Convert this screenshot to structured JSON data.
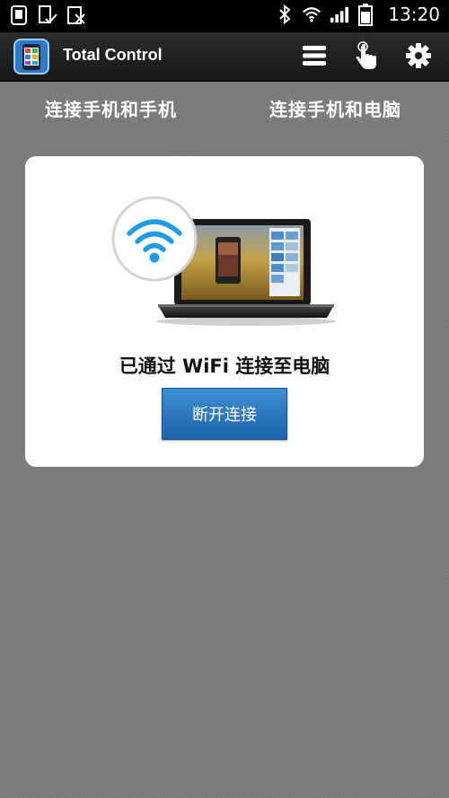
{
  "status_bar": {
    "time": "13:20",
    "icons_left": [
      "app-notification-icon",
      "download-check-icon",
      "blocked-sim-icon"
    ],
    "icons_right": [
      "bluetooth-icon",
      "wifi-signal-icon",
      "cell-signal-icon",
      "battery-icon"
    ]
  },
  "app_bar": {
    "title": "Total Control",
    "actions": [
      "menu-icon",
      "touch-hand-icon",
      "settings-gear-icon"
    ]
  },
  "top_tabs": {
    "phone_to_phone": "连接手机和手机",
    "phone_to_pc": "连接手机和电脑"
  },
  "card": {
    "status": "已通过 WiFi 连接至电脑",
    "disconnect_label": "断开连接"
  },
  "colors": {
    "accent_blue": "#2b7cc9",
    "wifi_icon": "#1f9be6",
    "appbar": "#1c1d1e",
    "background": "#7d7f7f"
  }
}
